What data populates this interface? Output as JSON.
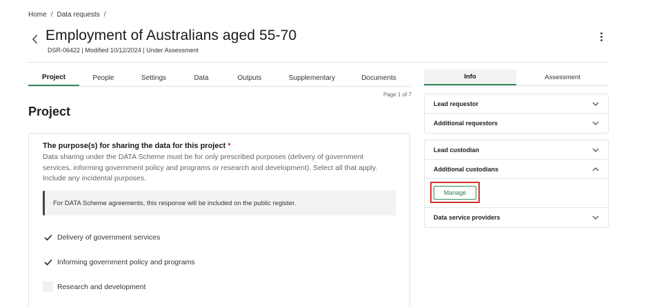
{
  "breadcrumb": {
    "items": [
      "Home",
      "Data requests"
    ],
    "separator": "/"
  },
  "header": {
    "title": "Employment of Australians aged 55-70",
    "meta": "DSR-06422 | Modified 10/12/2024 | Under Assessment"
  },
  "tabs": [
    "Project",
    "People",
    "Settings",
    "Data",
    "Outputs",
    "Supplementary",
    "Documents"
  ],
  "active_tab": "Project",
  "page_indicator": "Page 1 of 7",
  "section_title": "Project",
  "question": {
    "title": "The purpose(s) for sharing the data for this project",
    "required_mark": "*",
    "description": "Data sharing under the DATA Scheme must be for only prescribed purposes (delivery of government services, informing government policy and programs or research and development). Select all that apply. Include any incidental purposes.",
    "note": "For DATA Scheme agreements, this response will be included on the public register.",
    "options": [
      {
        "label": "Delivery of government services",
        "checked": true
      },
      {
        "label": "Informing government policy and programs",
        "checked": true
      },
      {
        "label": "Research and development",
        "checked": false
      }
    ]
  },
  "right_panel": {
    "tabs": [
      "Info",
      "Assessment"
    ],
    "active_tab": "Info",
    "group1": [
      "Lead requestor",
      "Additional requestors"
    ],
    "group2": {
      "lead_custodian": "Lead custodian",
      "additional_custodians": "Additional custodians",
      "manage_label": "Manage",
      "data_service_providers": "Data service providers"
    }
  },
  "colors": {
    "accent": "#2e8b57",
    "highlight": "#d0302b",
    "required": "#c0392b"
  },
  "icons": [
    "chevron-left-icon",
    "kebab-menu-icon",
    "chevron-down-icon",
    "chevron-up-icon",
    "checkmark-icon"
  ]
}
